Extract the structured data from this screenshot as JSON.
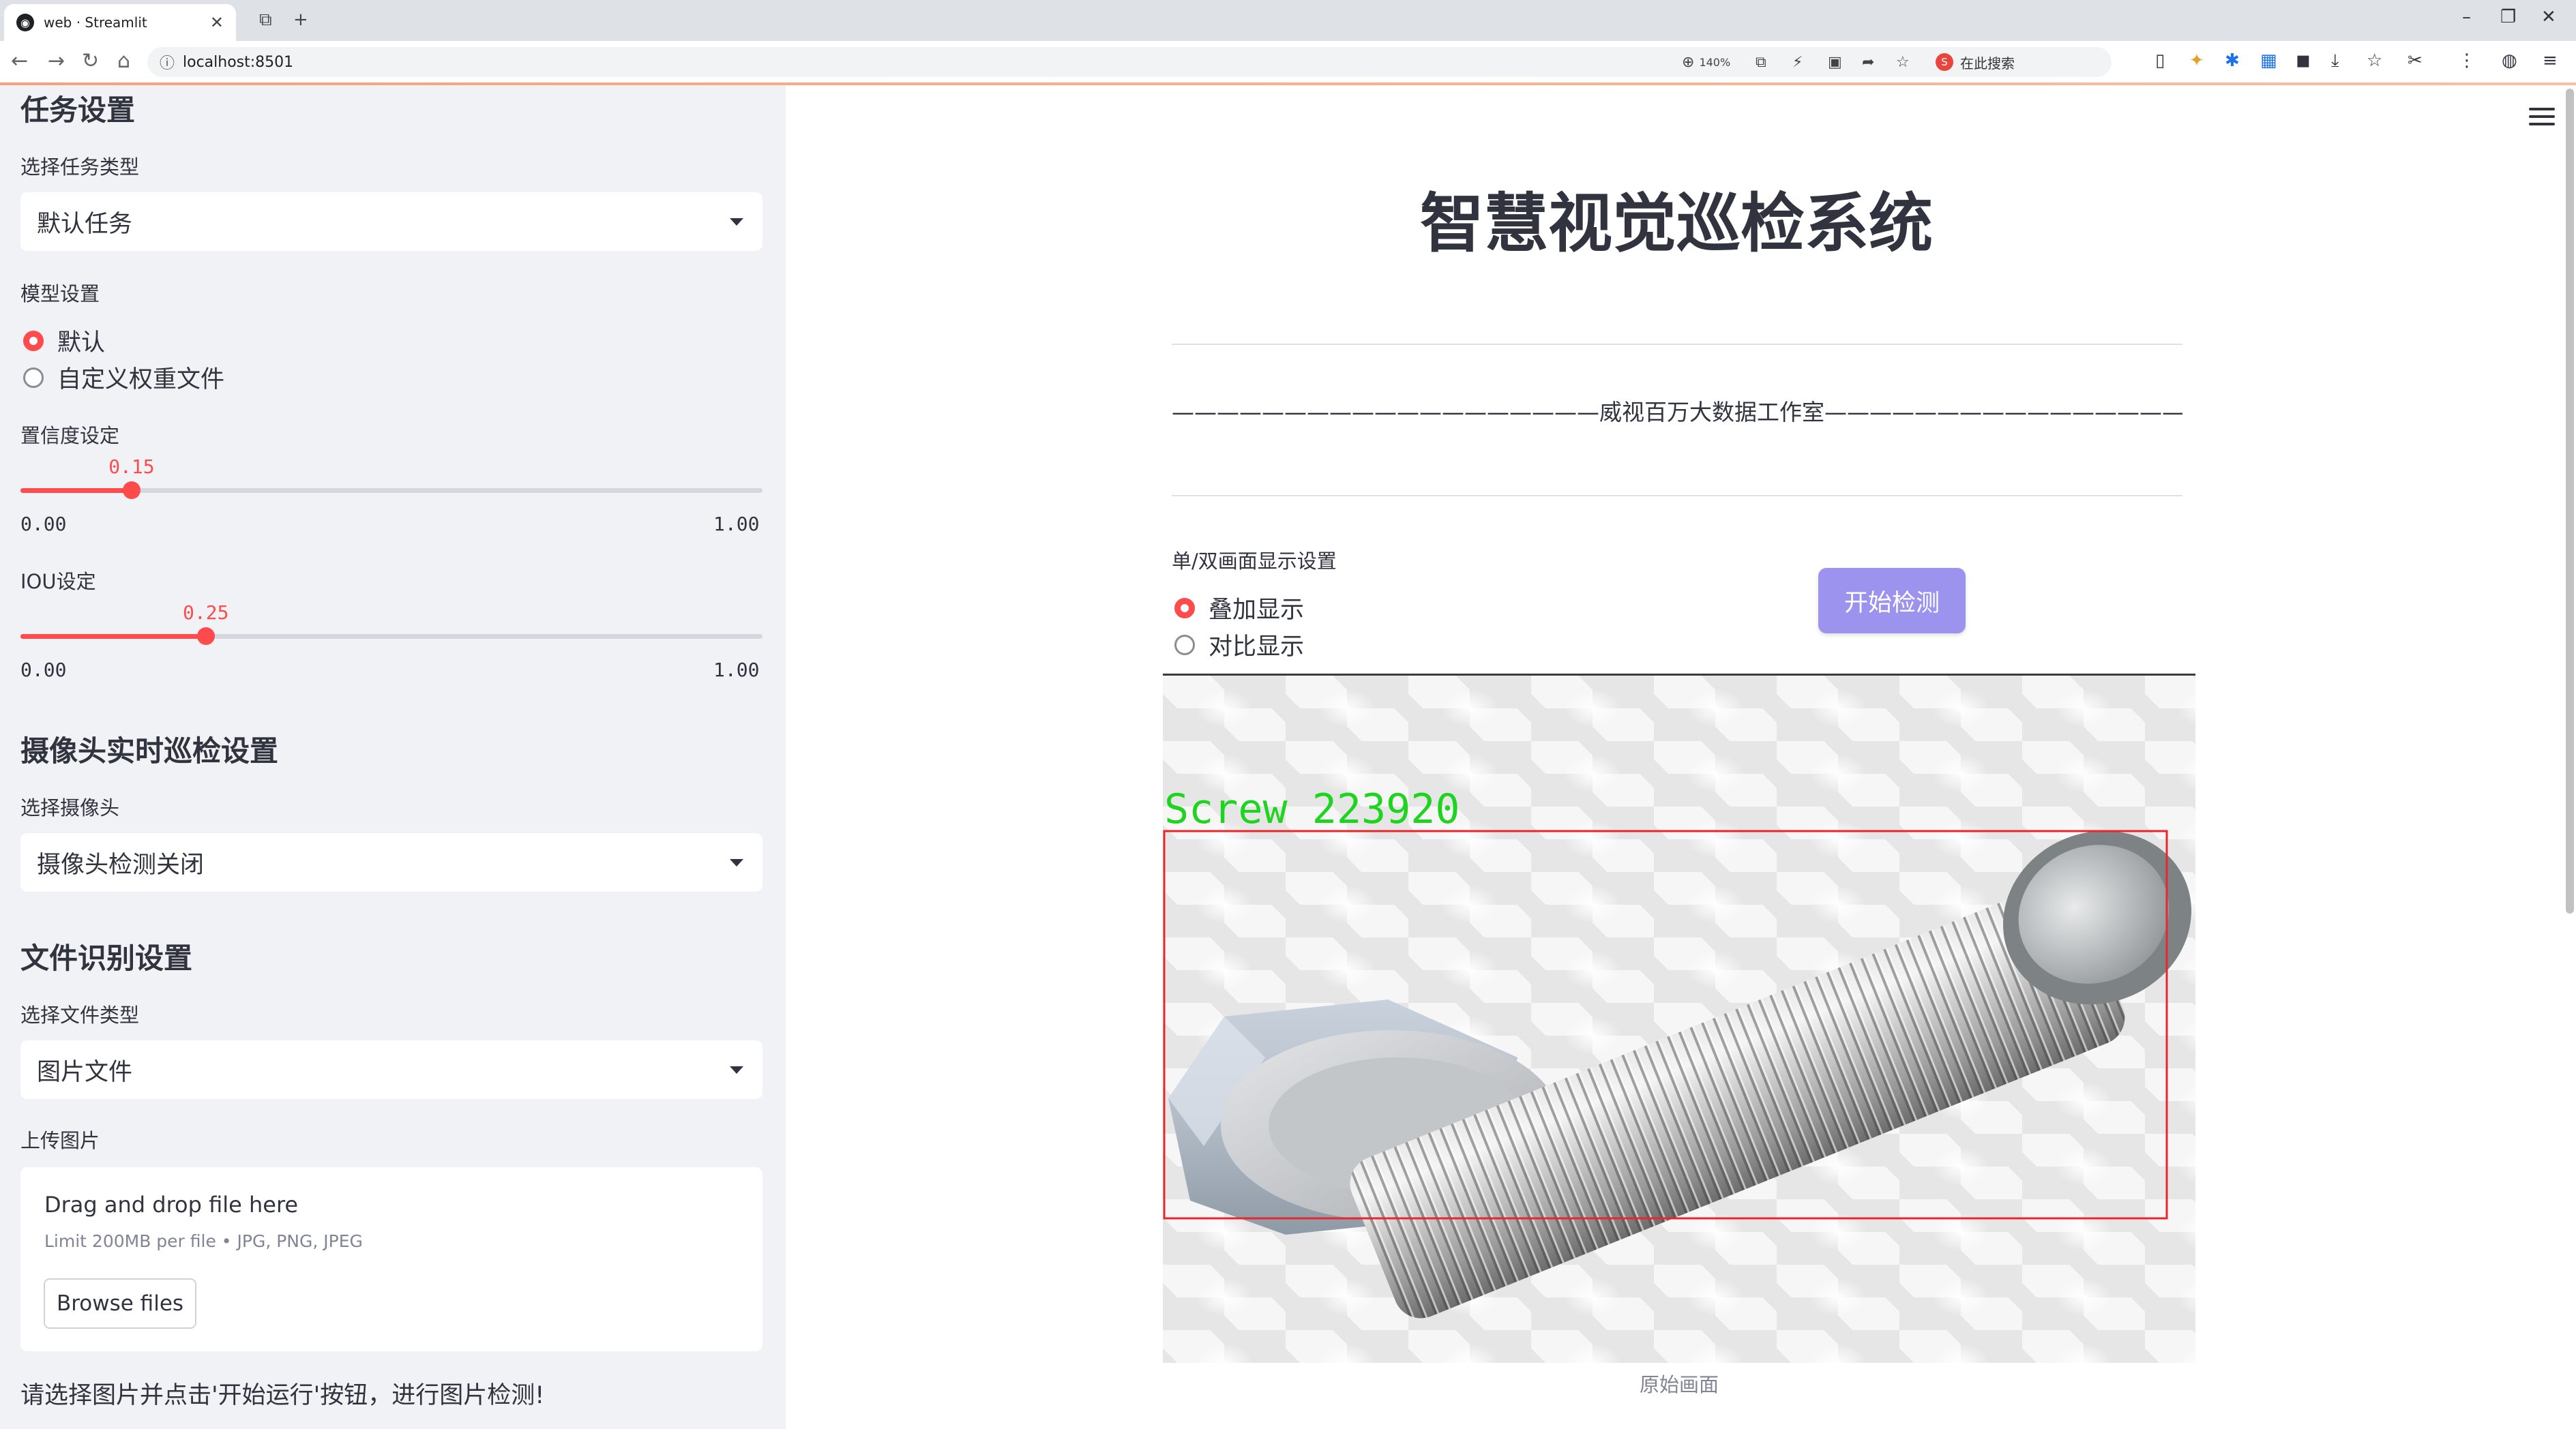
{
  "browser": {
    "tab_title": "web · Streamlit",
    "url": "localhost:8501",
    "zoom": "140%",
    "search_placeholder": "在此搜索"
  },
  "sidebar": {
    "task_heading": "任务设置",
    "task_type_label": "选择任务类型",
    "task_type_value": "默认任务",
    "model_label": "模型设置",
    "model_options": [
      "默认",
      "自定义权重文件"
    ],
    "model_selected": 0,
    "confidence": {
      "label": "置信度设定",
      "value": 0.15,
      "display": "0.15",
      "min": "0.00",
      "max": "1.00"
    },
    "iou": {
      "label": "IOU设定",
      "value": 0.25,
      "display": "0.25",
      "min": "0.00",
      "max": "1.00"
    },
    "camera_heading": "摄像头实时巡检设置",
    "camera_label": "选择摄像头",
    "camera_value": "摄像头检测关闭",
    "file_heading": "文件识别设置",
    "file_type_label": "选择文件类型",
    "file_type_value": "图片文件",
    "upload_label": "上传图片",
    "upload_drop": "Drag and drop file here",
    "upload_limit": "Limit 200MB per file • JPG, PNG, JPEG",
    "browse_label": "Browse files",
    "hint": "请选择图片并点击'开始运行'按钮，进行图片检测!"
  },
  "main": {
    "title": "智慧视觉巡检系统",
    "subtitle": "———————————————————威视百万大数据工作室————————————————————",
    "display_label": "单/双画面显示设置",
    "display_options": [
      "叠加显示",
      "对比显示"
    ],
    "display_selected": 0,
    "start_button": "开始检测",
    "detection_label": "Screw 223920",
    "caption": "原始画面"
  },
  "colors": {
    "accent": "#ff4b4b",
    "button": "#9c93ee",
    "detection_box": "#e8262c",
    "detection_text": "#1fd41f"
  }
}
